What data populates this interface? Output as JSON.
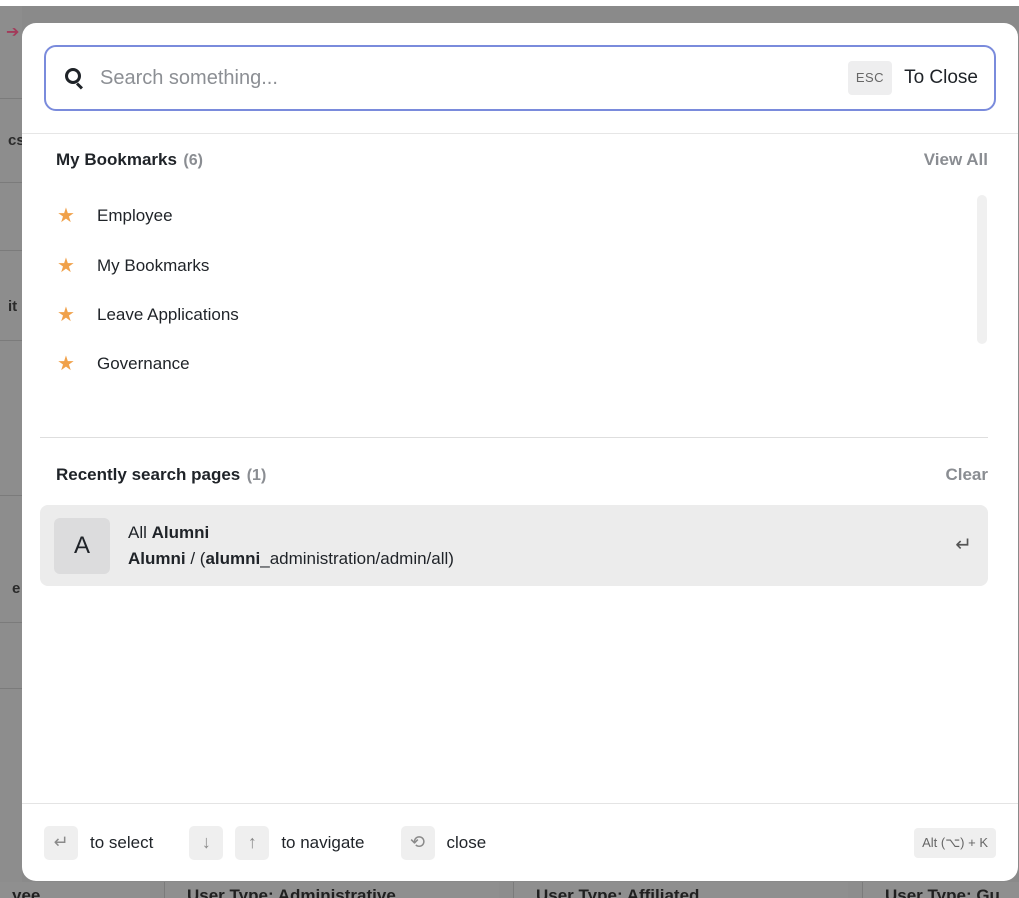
{
  "background": {
    "left_fragments": [
      "cs",
      "it",
      "e"
    ],
    "bottom_headers": [
      "yee",
      "User Type: Administrative",
      "User Type: Affiliated",
      "User Type: Gu"
    ]
  },
  "search": {
    "placeholder": "Search something...",
    "value": "",
    "esc_key": "ESC",
    "close_label": "To Close"
  },
  "bookmarks": {
    "title": "My Bookmarks",
    "count": "(6)",
    "action": "View All",
    "items": [
      {
        "label": "Employee",
        "icon": "star-icon"
      },
      {
        "label": "My Bookmarks",
        "icon": "star-icon"
      },
      {
        "label": "Leave Applications",
        "icon": "star-icon"
      },
      {
        "label": "Governance",
        "icon": "star-icon"
      }
    ]
  },
  "recent": {
    "title": "Recently search pages",
    "count": "(1)",
    "action": "Clear",
    "items": [
      {
        "avatar": "A",
        "line1_prefix": "All ",
        "line1_bold": "Alumni",
        "line2_bold1": "Alumni",
        "line2_mid": " / (",
        "line2_bold2": "alumni",
        "line2_rest": "_administration/admin/all)",
        "enter_glyph": "↵"
      }
    ]
  },
  "footer": {
    "select_key": "↵",
    "select_label": "to select",
    "down_key": "↓",
    "up_key": "↑",
    "navigate_label": "to navigate",
    "close_key": "⟲",
    "close_label": "close",
    "shortcut": "Alt (⌥) + K"
  },
  "colors": {
    "accent_border": "#7a8bdc",
    "star": "#f0a14a",
    "muted_text": "#8a8d92"
  }
}
